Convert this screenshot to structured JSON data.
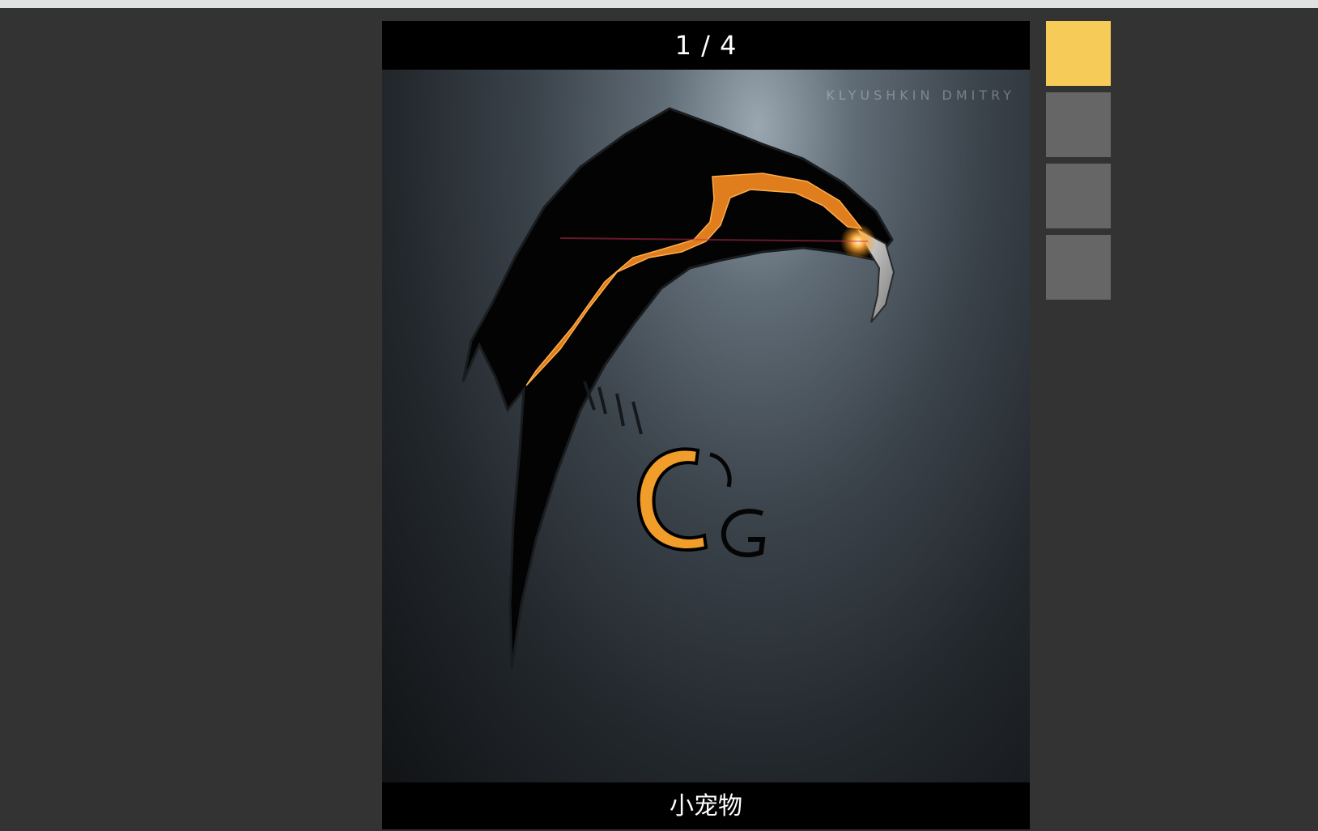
{
  "viewer": {
    "counter": "1 / 4",
    "caption": "小宠物",
    "image": {
      "subject": "stylized black bird logo with orange glow",
      "watermark": "Klyushkin Dmitry"
    }
  },
  "thumbnails": {
    "count": 4,
    "active_index": 0,
    "colors": {
      "active": "#f7cb57",
      "inactive": "#666666"
    }
  },
  "colors": {
    "page_background": "#333333",
    "bar_background": "#000000",
    "accent": "#f7cb57"
  }
}
